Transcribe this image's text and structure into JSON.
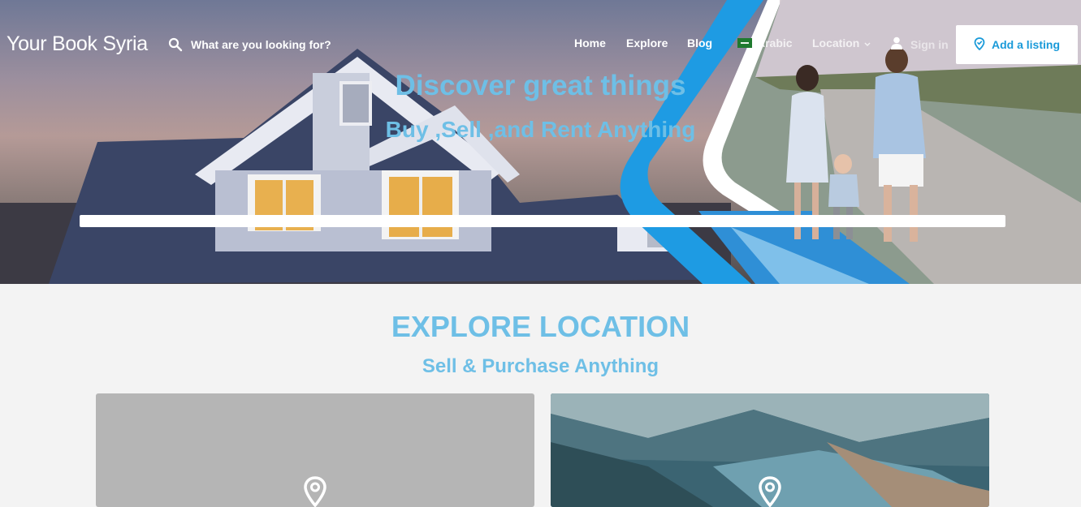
{
  "header": {
    "logo": "Your Book Syria",
    "search_placeholder": "What are you looking for?",
    "nav": {
      "home": "Home",
      "explore": "Explore",
      "blog": "Blog",
      "language": "Arabic",
      "location": "Location",
      "signin": "Sign in"
    },
    "add_listing": "Add a listing"
  },
  "hero": {
    "title": "Discover great things",
    "subtitle": "Buy ,Sell ,and Rent Anything"
  },
  "explore": {
    "title": "EXPLORE LOCATION",
    "subtitle": "Sell & Purchase Anything"
  },
  "colors": {
    "accent": "#6ebfe6",
    "button_text": "#1a9ad9",
    "hero_swoosh": "#1e9be3"
  },
  "icons": [
    "search-icon",
    "flag-icon",
    "chevron-down-icon",
    "user-icon",
    "location-pin-icon"
  ]
}
